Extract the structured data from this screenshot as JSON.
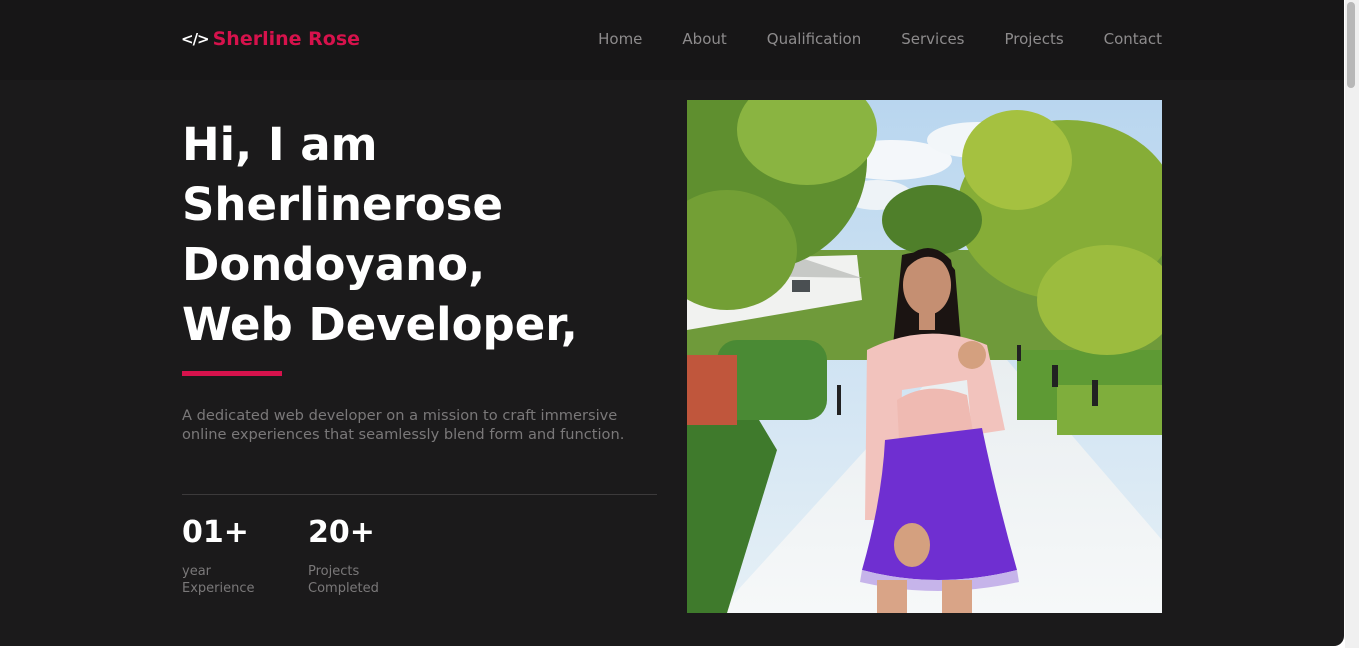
{
  "header": {
    "logo_icon": "</>",
    "brand": "Sherline Rose",
    "nav": [
      "Home",
      "About",
      "Qualification",
      "Services",
      "Projects",
      "Contact"
    ]
  },
  "hero": {
    "title_lines": [
      "Hi, I am",
      "Sherlinerose",
      "Dondoyano,",
      "Web Developer,"
    ],
    "description": "A dedicated web developer on a mission to craft immersive online experiences that seamlessly blend form and function.",
    "stats": [
      {
        "value": "01+",
        "label_lines": [
          "year",
          "Experience"
        ]
      },
      {
        "value": "20+",
        "label_lines": [
          "Projects",
          "Completed"
        ]
      }
    ]
  },
  "colors": {
    "background": "#1b1a1b",
    "navbar": "#171617",
    "accent": "#d6124c",
    "text_primary": "#ffffff",
    "text_muted": "#7a7879"
  },
  "icons": {
    "logo": "code-icon"
  }
}
